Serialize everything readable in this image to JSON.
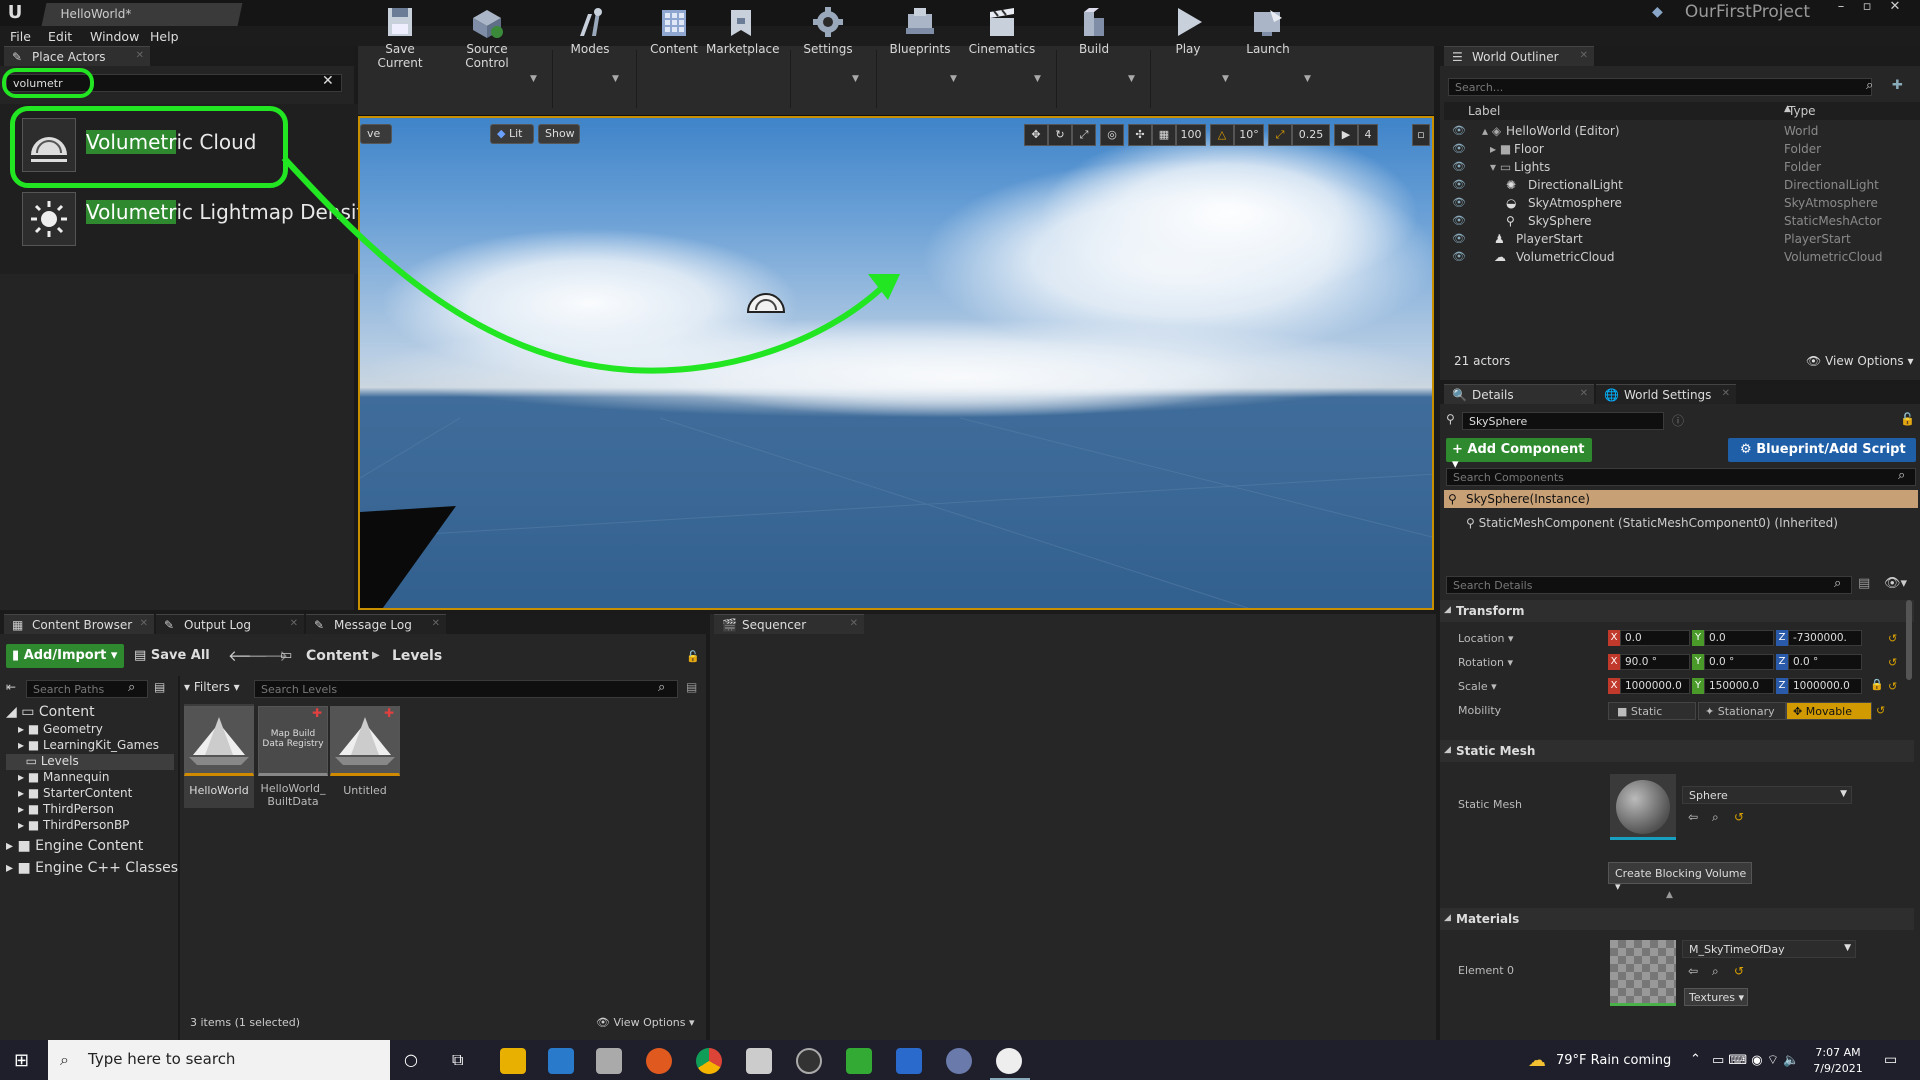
{
  "window": {
    "doc_tab": "HelloWorld*",
    "project_name": "OurFirstProject"
  },
  "menu": [
    "File",
    "Edit",
    "Window",
    "Help"
  ],
  "place_actors": {
    "tab": "Place Actors",
    "search_value": "volumetr",
    "results": [
      {
        "prefix": "Volumetr",
        "rest": "ic Cloud"
      },
      {
        "prefix": "Volumetr",
        "rest": "ic Lightmap Density Volume"
      }
    ]
  },
  "toolbar": [
    "Save Current",
    "Source Control",
    "Modes",
    "Content",
    "Marketplace",
    "Settings",
    "Blueprints",
    "Cinematics",
    "Build",
    "Play",
    "Launch"
  ],
  "viewport": {
    "buttons": [
      "ve",
      "Lit",
      "Show"
    ],
    "grid_snap": "100",
    "angle_snap": "10°",
    "scale_snap": "0.25",
    "camera_speed": "4"
  },
  "outliner": {
    "tab": "World Outliner",
    "search_placeholder": "Search...",
    "col_label": "Label",
    "col_type": "Type",
    "rows": [
      {
        "label": "HelloWorld (Editor)",
        "type": "World"
      },
      {
        "label": "Floor",
        "type": "Folder"
      },
      {
        "label": "Lights",
        "type": "Folder"
      },
      {
        "label": "DirectionalLight",
        "type": "DirectionalLight"
      },
      {
        "label": "SkyAtmosphere",
        "type": "SkyAtmosphere"
      },
      {
        "label": "SkySphere",
        "type": "StaticMeshActor"
      },
      {
        "label": "PlayerStart",
        "type": "PlayerStart"
      },
      {
        "label": "VolumetricCloud",
        "type": "VolumetricCloud"
      }
    ],
    "actor_count": "21 actors",
    "view_options": "View Options"
  },
  "details": {
    "tab": "Details",
    "tab2": "World Settings",
    "name_value": "SkySphere",
    "add_component": "+ Add Component",
    "blueprint_btn": "Blueprint/Add Script",
    "search_components": "Search Components",
    "instance_row": "SkySphere(Instance)",
    "component_row": "StaticMeshComponent (StaticMeshComponent0) (Inherited)",
    "search_details": "Search Details",
    "transform": {
      "section": "Transform",
      "location_label": "Location",
      "location": [
        "0.0",
        "0.0",
        "-7300000."
      ],
      "rotation_label": "Rotation",
      "rotation": [
        "90.0 °",
        "0.0 °",
        "0.0 °"
      ],
      "scale_label": "Scale",
      "scale": [
        "1000000.0",
        "150000.0",
        "1000000.0"
      ],
      "mobility_label": "Mobility",
      "mobility": [
        "Static",
        "Stationary",
        "Movable"
      ]
    },
    "static_mesh": {
      "section": "Static Mesh",
      "label": "Static Mesh",
      "value": "Sphere",
      "create_blocking": "Create Blocking Volume"
    },
    "materials": {
      "section": "Materials",
      "label": "Element 0",
      "value": "M_SkyTimeOfDay",
      "textures": "Textures"
    }
  },
  "content_browser": {
    "tabs": [
      "Content Browser",
      "Output Log",
      "Message Log"
    ],
    "add_import": "Add/Import",
    "save_all": "Save All",
    "path": [
      "Content",
      "Levels"
    ],
    "search_paths": "Search Paths",
    "filters": "Filters",
    "search_levels": "Search Levels",
    "folders": [
      "Content",
      "Geometry",
      "LearningKit_Games",
      "Levels",
      "Mannequin",
      "StarterContent",
      "ThirdPerson",
      "ThirdPersonBP",
      "Engine Content",
      "Engine C++ Classes"
    ],
    "assets": [
      {
        "name": "HelloWorld"
      },
      {
        "name": "HelloWorld_ BuiltData",
        "thumb_text": "Map Build Data Registry"
      },
      {
        "name": "Untitled"
      }
    ],
    "status": "3 items (1 selected)",
    "view_options": "View Options"
  },
  "sequencer": {
    "tab": "Sequencer"
  },
  "taskbar": {
    "search_placeholder": "Type here to search",
    "weather": "79°F Rain coming",
    "time": "7:07 AM",
    "date": "7/9/2021"
  },
  "colors": {
    "accent_green": "#21e621",
    "details_orange": "#c89000",
    "add_green": "#2f8a2f",
    "blueprint_blue": "#1f5fa8"
  }
}
